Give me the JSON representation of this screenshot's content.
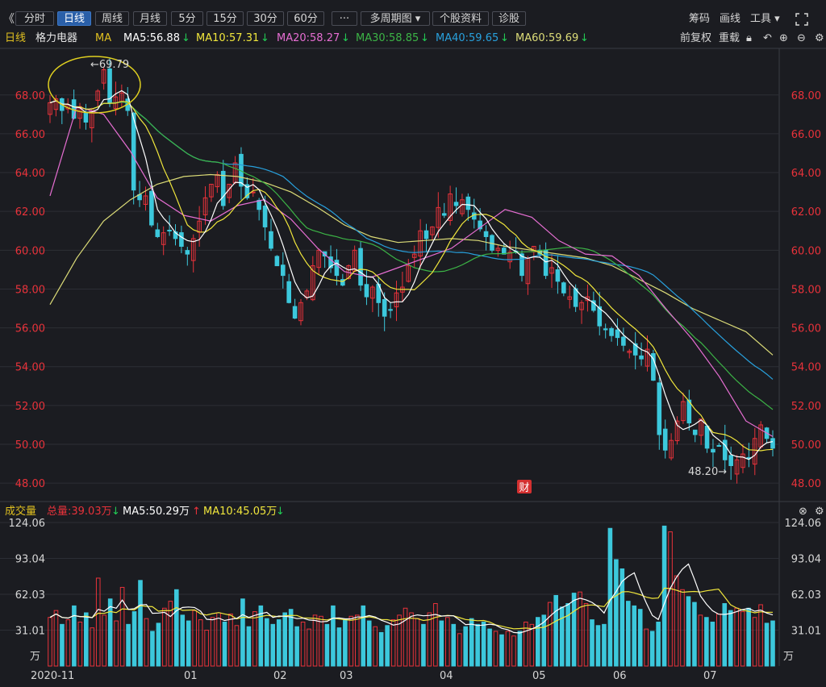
{
  "toolbar": {
    "back_icon": "《",
    "buttons": [
      "分时",
      "日线",
      "周线",
      "月线",
      "5分",
      "15分",
      "30分",
      "60分",
      "···",
      "多周期图 ▾",
      "个股资料",
      "诊股"
    ],
    "active": "日线",
    "right": [
      "筹码",
      "画线",
      "工具 ▾"
    ]
  },
  "ma_bar": {
    "period": "日线",
    "stock_name": "格力电器",
    "ma_label": "MA",
    "ma5": "MA5:56.88",
    "ma10": "MA10:57.31",
    "ma20": "MA20:58.27",
    "ma30": "MA30:58.85",
    "ma40": "MA40:59.65",
    "ma60": "MA60:59.69",
    "right": [
      "前复权",
      "重载"
    ]
  },
  "vol_bar": {
    "label": "成交量",
    "total": "总量:39.03万",
    "ma5": "MA5:50.29万",
    "ma10": "MA10:45.05万"
  },
  "colors": {
    "up": "#e8323a",
    "down": "#3cc8dc",
    "ma5": "#ffffff",
    "ma10": "#f0e63c",
    "ma20": "#e66ed2",
    "ma30": "#3cb446",
    "ma40": "#28a0dc",
    "ma60": "#dcdc78",
    "grid": "#2c2e35"
  },
  "chart_data": [
    {
      "type": "candlestick",
      "title": "格力电器 日线",
      "ylim": [
        47.3,
        70.4
      ],
      "y_ticks": [
        "68.00",
        "66.00",
        "64.00",
        "62.00",
        "60.00",
        "58.00",
        "56.00",
        "54.00",
        "52.00",
        "50.00",
        "48.00"
      ],
      "x_ticks": [
        "2020-11",
        "01",
        "02",
        "03",
        "04",
        "05",
        "06",
        "07"
      ],
      "high_label": "←69.79",
      "low_label": "48.20→",
      "badge": "财",
      "close_series": [
        67.6,
        67.8,
        67.2,
        67.5,
        66.8,
        67.4,
        66.6,
        67.3,
        68.2,
        69.3,
        67.6,
        67.9,
        68.1,
        67.2,
        63.1,
        62.6,
        62.8,
        61.3,
        60.7,
        60.9,
        61.0,
        60.6,
        60.2,
        59.8,
        60.6,
        61.5,
        62.7,
        63.4,
        63.9,
        62.3,
        63.4,
        64.5,
        63.3,
        62.7,
        63.0,
        62.1,
        61.2,
        60.1,
        59.2,
        58.7,
        57.3,
        56.5,
        57.3,
        57.9,
        59.2,
        60.0,
        59.7,
        59.1,
        58.7,
        58.2,
        59.2,
        60.0,
        58.2,
        57.6,
        58.1,
        57.3,
        56.6,
        56.9,
        57.8,
        58.1,
        59.2,
        59.8,
        61.0,
        60.6,
        61.2,
        62.2,
        61.8,
        62.9,
        62.3,
        62.6,
        62.1,
        61.6,
        61.1,
        60.7,
        60.0,
        60.1,
        59.8,
        59.9,
        59.9,
        58.7,
        59.6,
        60.2,
        59.8,
        58.7,
        59.1,
        58.4,
        57.8,
        57.6,
        57.1,
        57.3,
        57.6,
        56.9,
        56.1,
        55.9,
        55.6,
        55.5,
        55.1,
        54.8,
        54.6,
        54.4,
        54.9,
        53.3,
        50.5,
        49.7,
        50.2,
        51.2,
        52.2,
        51.1,
        50.5,
        51.3,
        49.8,
        49.6,
        49.9,
        49.2,
        48.9,
        49.2,
        49.5,
        49.3,
        50.3,
        51.0,
        50.3,
        49.8
      ],
      "ma60_series": [
        57.2,
        59.6,
        61.5,
        62.6,
        63.4,
        63.8,
        63.9,
        63.8,
        63.5,
        63.0,
        62.2,
        61.3,
        60.7,
        60.4,
        60.5,
        60.6,
        60.5,
        60.2,
        60.0,
        59.8,
        59.6,
        59.2,
        58.5,
        57.8,
        57.0,
        56.4,
        55.8,
        54.6
      ],
      "ma20_series": [
        62.8,
        67.4,
        67.0,
        65.1,
        62.7,
        61.8,
        61.5,
        62.3,
        62.6,
        61.6,
        60.1,
        58.9,
        58.6,
        59.1,
        59.6,
        60.1,
        61.1,
        62.1,
        61.7,
        60.5,
        59.8,
        59.7,
        58.7,
        57.0,
        55.4,
        53.5,
        51.2,
        50.4
      ]
    },
    {
      "type": "bar",
      "title": "成交量",
      "y_unit": "万",
      "ylim": [
        0,
        124.06
      ],
      "y_ticks": [
        "124.06",
        "93.04",
        "62.03",
        "31.01"
      ],
      "values": [
        42,
        48,
        36,
        40,
        52,
        38,
        46,
        33,
        76,
        44,
        58,
        39,
        68,
        36,
        47,
        74,
        41,
        30,
        37,
        50,
        56,
        66,
        44,
        39,
        48,
        40,
        31,
        42,
        46,
        38,
        45,
        35,
        58,
        34,
        47,
        52,
        41,
        36,
        40,
        46,
        49,
        34,
        38,
        32,
        44,
        43,
        36,
        52,
        33,
        40,
        43,
        44,
        52,
        39,
        34,
        29,
        35,
        40,
        44,
        50,
        46,
        41,
        36,
        46,
        54,
        39,
        42,
        36,
        28,
        34,
        41,
        36,
        38,
        32,
        30,
        27,
        30,
        26,
        30,
        38,
        36,
        42,
        44,
        55,
        61,
        51,
        54,
        63,
        64,
        54,
        40,
        35,
        36,
        119,
        92,
        84,
        56,
        52,
        49,
        32,
        30,
        38,
        121,
        116,
        78,
        66,
        60,
        55,
        44,
        42,
        38,
        45,
        54,
        48,
        50,
        47,
        50,
        42,
        53,
        37,
        39
      ]
    }
  ]
}
